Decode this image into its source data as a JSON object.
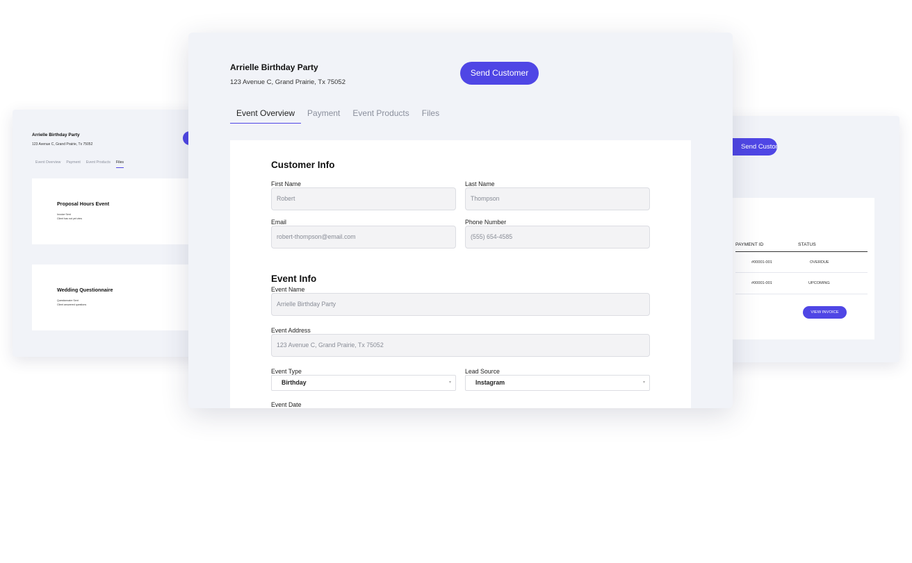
{
  "left_card": {
    "title": "Arrielle Birthday Party",
    "address": "123 Avenue C, Grand Prairie, Tx 75052",
    "tabs": [
      "Event Overview",
      "Payment",
      "Event Products",
      "Files"
    ],
    "boxes": [
      {
        "title": "Proposal Hours Event",
        "lines": [
          "Invoice Sent",
          "Client has not yet view"
        ]
      },
      {
        "title": "Wedding Questionnaire",
        "lines": [
          "Questionnaire Sent",
          "Client answered questions"
        ]
      }
    ]
  },
  "right_card": {
    "send_label": "Send Customer",
    "headers": [
      "PAYMENT ID",
      "STATUS"
    ],
    "rows": [
      {
        "payment_id": "#00001-001",
        "status": "OVERDUE"
      },
      {
        "payment_id": "#00001-001",
        "status": "UPCOMING"
      }
    ],
    "view_invoice_label": "VIEW INVOICE"
  },
  "main": {
    "title": "Arrielle Birthday Party",
    "address": "123 Avenue C, Grand Prairie, Tx 75052",
    "send_label": "Send Customer",
    "tabs": [
      "Event Overview",
      "Payment",
      "Event Products",
      "Files"
    ],
    "customer_info": {
      "heading": "Customer Info",
      "first_name_label": "First Name",
      "first_name_value": "Robert",
      "last_name_label": "Last Name",
      "last_name_value": "Thompson",
      "email_label": "Email",
      "email_value": "robert-thompson@email.com",
      "phone_label": "Phone Number",
      "phone_value": "(555) 654-4585"
    },
    "event_info": {
      "heading": "Event Info",
      "name_label": "Event Name",
      "name_value": "Arrielle Birthday Party",
      "address_label": "Event Address",
      "address_value": "123 Avenue C, Grand Prairie, Tx 75052",
      "type_label": "Event Type",
      "type_value": "Birthday",
      "lead_label": "Lead Source",
      "lead_value": "Instagram",
      "date_label": "Event Date"
    }
  },
  "colors": {
    "accent": "#4f46e5",
    "card_bg": "#f1f3f8"
  },
  "icons": {
    "select_chevron": "chevron-down-icon"
  }
}
